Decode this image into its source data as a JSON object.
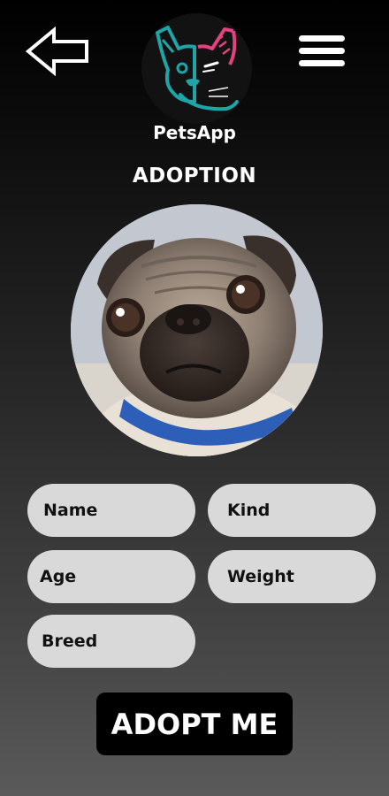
{
  "header": {
    "back_icon": "arrow-left-outline-icon",
    "menu_icon": "hamburger-menu-icon",
    "logo_icon": "french-bulldog-logo-icon",
    "app_name": "PetsApp",
    "colors": {
      "logo_teal": "#1fa5a8",
      "logo_pink": "#e2427e"
    }
  },
  "page": {
    "title": "ADOPTION"
  },
  "pet": {
    "photo": "pug-puppy-photo"
  },
  "form": {
    "name_placeholder": "Name",
    "kind_placeholder": "Kind",
    "age_placeholder": "Age",
    "weight_placeholder": "Weight",
    "breed_placeholder": "Breed"
  },
  "actions": {
    "adopt_label": "ADOPT ME"
  }
}
